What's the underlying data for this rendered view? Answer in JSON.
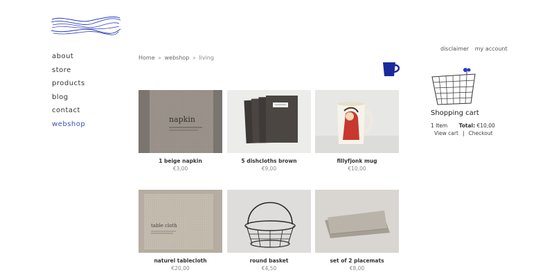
{
  "nav": {
    "items": [
      {
        "label": "about"
      },
      {
        "label": "store"
      },
      {
        "label": "products"
      },
      {
        "label": "blog"
      },
      {
        "label": "contact"
      },
      {
        "label": "webshop"
      }
    ],
    "active_color": "#3a4fb3"
  },
  "header": {
    "disclaimer": "disclaimer",
    "my_account": "my account"
  },
  "breadcrumb": {
    "home": "Home",
    "webshop": "webshop",
    "current": "living",
    "separator": "»"
  },
  "category_icon": "mug-icon",
  "products": [
    {
      "name": "1 beige napkin",
      "price": "€3,00",
      "image": "napkin-photo",
      "label_text": "napkin"
    },
    {
      "name": "5 dishcloths brown",
      "price": "€9,00",
      "image": "dishcloths-photo"
    },
    {
      "name": "fillyfjonk mug",
      "price": "€10,00",
      "image": "mug-photo"
    },
    {
      "name": "naturel tablecloth",
      "price": "€20,00",
      "image": "tablecloth-photo",
      "label_text": "table cloth"
    },
    {
      "name": "round basket",
      "price": "€4,50",
      "image": "basket-photo"
    },
    {
      "name": "set of 2 placemats",
      "price": "€8,00",
      "image": "placemats-photo"
    }
  ],
  "cart": {
    "title": "Shopping cart",
    "items": "1 Item",
    "total_label": "Total:",
    "total_value": "€10,00",
    "view_cart": "View cart",
    "separator": "|",
    "checkout": "Checkout"
  }
}
